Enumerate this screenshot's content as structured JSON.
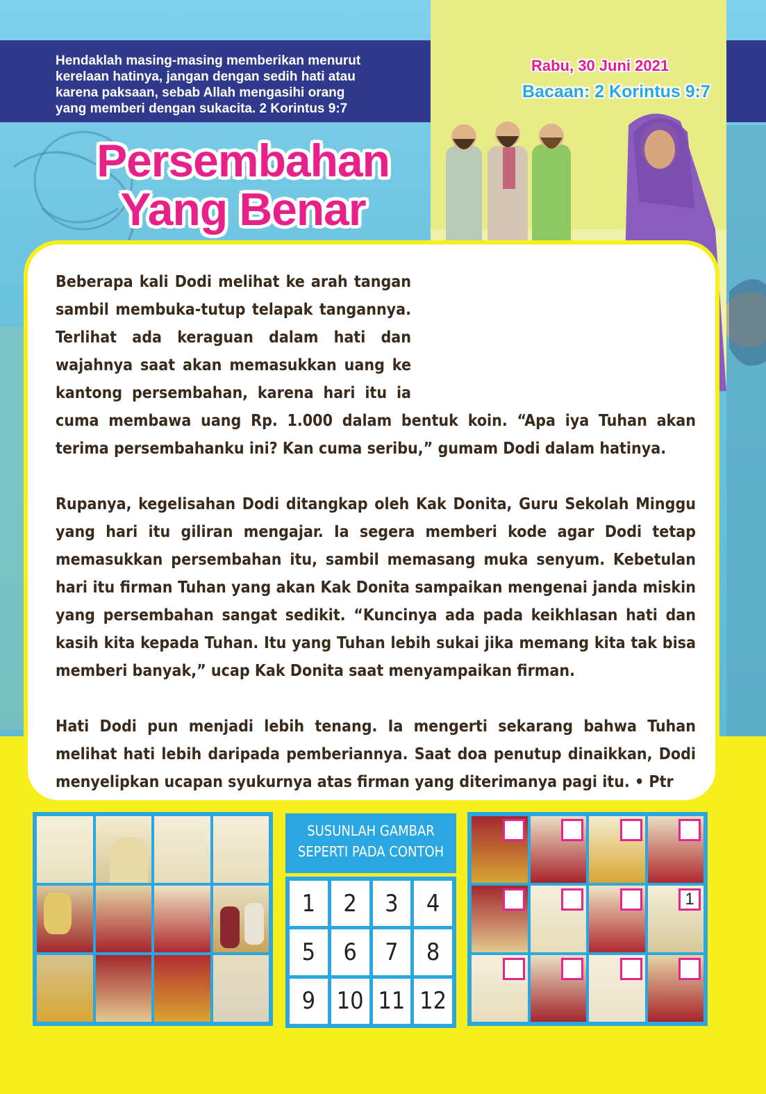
{
  "verse": "Hendaklah masing-masing memberikan menurut\nkerelaan hatinya, jangan dengan sedih hati atau\nkarena paksaan, sebab Allah mengasihi orang\nyang memberi dengan sukacita. 2 Korintus 9:7",
  "date": "Rabu, 30 Juni 2021",
  "reading": "Bacaan: 2 Korintus 9:7",
  "title": "Persembahan\nYang Benar",
  "story": {
    "p1": "Beberapa kali Dodi melihat ke arah tangan sambil membuka-tutup telapak tangannya. Terlihat ada keraguan dalam hati dan wajahnya saat akan memasukkan uang ke kantong persembahan, karena hari itu ia cuma membawa uang Rp. 1.000 dalam bentuk koin. “Apa iya Tuhan akan terima persembahanku ini? Kan cuma seribu,” gumam Dodi dalam hatinya.",
    "p2": "Rupanya, kegelisahan Dodi ditangkap oleh Kak Donita, Guru Sekolah Minggu yang hari itu giliran mengajar. Ia segera memberi kode agar Dodi tetap memasukkan persembahan itu, sambil memasang muka senyum. Kebetulan hari itu firman Tuhan yang akan Kak Donita sampaikan mengenai janda miskin yang persembahan sangat sedikit. “Kuncinya ada pada keikhlasan hati dan kasih kita kepada Tuhan. Itu yang Tuhan lebih sukai jika memang kita tak bisa memberi banyak,” ucap Kak Donita saat menyampaikan firman.",
    "p3": "Hati Dodi pun menjadi lebih tenang. Ia mengerti sekarang bahwa Tuhan melihat hati lebih daripada pemberiannya. Saat doa penutup dinaikkan, Dodi menyelipkan ucapan syukurnya atas firman yang diterimanya pagi itu. • Ptr"
  },
  "puzzle": {
    "instruction_line1": "SUSUNLAH GAMBAR",
    "instruction_line2": "SEPERTI PADA CONTOH",
    "numbers": [
      "1",
      "2",
      "3",
      "4",
      "5",
      "6",
      "7",
      "8",
      "9",
      "10",
      "11",
      "12"
    ],
    "answer_boxes": [
      "",
      "",
      "",
      "",
      "",
      "",
      "",
      "1",
      "",
      "",
      "",
      ""
    ]
  },
  "colors": {
    "page_yellow": "#f7ef1d",
    "verse_band": "#2f3a8c",
    "title_pink": "#e8208a",
    "accent_blue": "#2aa6e0",
    "text_brown": "#3a2a1c"
  }
}
